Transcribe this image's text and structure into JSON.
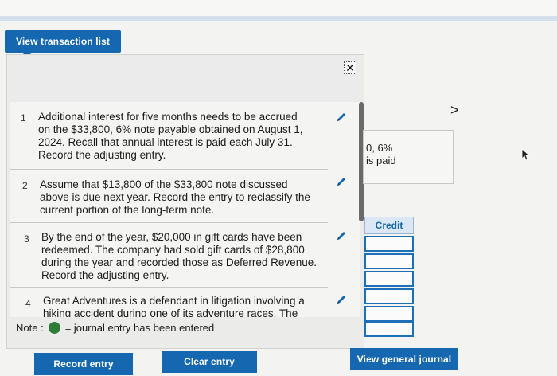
{
  "header": {
    "view_list_button": "View transaction list"
  },
  "panel": {
    "close_symbol": "✕"
  },
  "items": [
    {
      "num": "1",
      "lines": [
        "Additional interest for five months needs to be accrued",
        "on the $33,800, 6% note payable obtained on August 1,",
        "2024. Recall that annual interest is paid each July 31.",
        "Record the adjusting entry."
      ]
    },
    {
      "num": "2",
      "lines": [
        "Assume that $13,800 of the $33,800 note discussed",
        "above is due next year. Record the entry to reclassify the",
        "current portion of the long-term note."
      ]
    },
    {
      "num": "3",
      "lines": [
        "By the end of the year, $20,000 in gift cards have been",
        "redeemed. The company had sold gift cards of $28,800",
        "during the year and recorded those as Deferred Revenue.",
        "Record the adjusting entry."
      ]
    },
    {
      "num": "4",
      "lines": [
        "Great Adventures is a defendant in litigation involving a",
        "hiking accident during one of its adventure races. The"
      ]
    }
  ],
  "note": {
    "prefix": "Note :",
    "suffix": "= journal entry has been entered",
    "dot_color": "#2d7d3a"
  },
  "side": {
    "line1": "0, 6%",
    "line2": "is paid",
    "chevron": ">"
  },
  "credit": {
    "header": "Credit"
  },
  "buttons": {
    "record": "Record entry",
    "clear": "Clear entry",
    "general": "View general journal"
  },
  "colors": {
    "accent": "#1567b0"
  }
}
